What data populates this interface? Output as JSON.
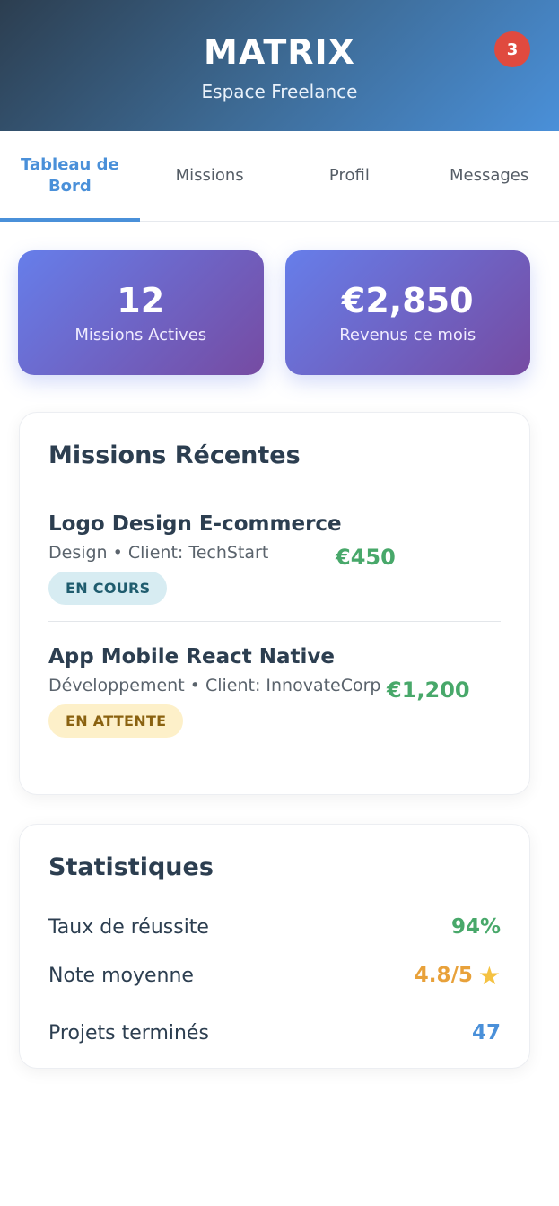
{
  "header": {
    "brand": "MATRIX",
    "subtitle": "Espace Freelance",
    "notification_count": "3"
  },
  "tabs": [
    {
      "label": "Tableau de Bord",
      "active": true
    },
    {
      "label": "Missions",
      "active": false
    },
    {
      "label": "Profil",
      "active": false
    },
    {
      "label": "Messages",
      "active": false
    }
  ],
  "summary": [
    {
      "value": "12",
      "label": "Missions Actives"
    },
    {
      "value": "€2,850",
      "label": "Revenus ce mois"
    }
  ],
  "recent": {
    "title": "Missions Récentes",
    "missions": [
      {
        "title": "Logo Design E-commerce",
        "meta": "Design • Client: TechStart",
        "price": "€450",
        "status": "EN COURS"
      },
      {
        "title": "App Mobile React Native",
        "meta": "Développement • Client: InnovateCorp",
        "price": "€1,200",
        "status": "EN ATTENTE"
      }
    ]
  },
  "stats": {
    "title": "Statistiques",
    "items": [
      {
        "label": "Taux de réussite",
        "value": "94%"
      },
      {
        "label": "Note moyenne",
        "value": "4.8/5",
        "icon": "star-icon"
      },
      {
        "label": "Projets terminés",
        "value": "47"
      }
    ]
  },
  "colors": {
    "accent": "#4a90d9",
    "success": "#48a86a",
    "rating": "#e8a13a",
    "badge": "#e04a3f"
  }
}
